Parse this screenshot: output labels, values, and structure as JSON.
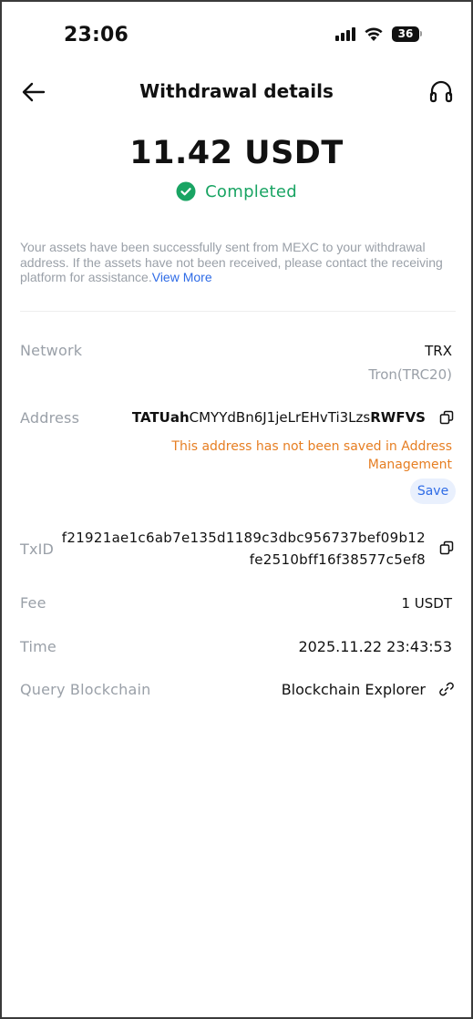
{
  "status_bar": {
    "time": "23:06",
    "battery": "36"
  },
  "header": {
    "title": "Withdrawal details"
  },
  "summary": {
    "amount": "11.42 USDT",
    "status": "Completed"
  },
  "info": {
    "message": "Your assets have been successfully sent from MEXC to your withdrawal address. If the assets have not been received, please contact the receiving platform for assistance.",
    "link": "View More"
  },
  "details": {
    "network": {
      "label": "Network",
      "value": "TRX",
      "sub": "Tron(TRC20)"
    },
    "address": {
      "label": "Address",
      "prefix": "TATUah",
      "middle": "CMYYdBn6J1jeLrEHvTi3Lzs",
      "suffix": "RWFVS",
      "warning": "This address has not been saved in Address Management",
      "save_label": "Save"
    },
    "txid": {
      "label": "TxID",
      "value": "f21921ae1c6ab7e135d1189c3dbc956737bef09b12fe2510bff16f38577c5ef8"
    },
    "fee": {
      "label": "Fee",
      "value": "1 USDT"
    },
    "time": {
      "label": "Time",
      "value": "2025.11.22 23:43:53"
    },
    "query": {
      "label": "Query Blockchain",
      "value": "Blockchain Explorer"
    }
  },
  "icons": [
    "back-arrow-icon",
    "headset-icon",
    "check-circle-icon",
    "copy-icon",
    "link-icon",
    "signal-icon",
    "wifi-icon",
    "battery-icon"
  ],
  "colors": {
    "success": "#19a463",
    "link": "#2e6be6",
    "warning": "#e67e22",
    "muted": "#9aa0a8"
  }
}
